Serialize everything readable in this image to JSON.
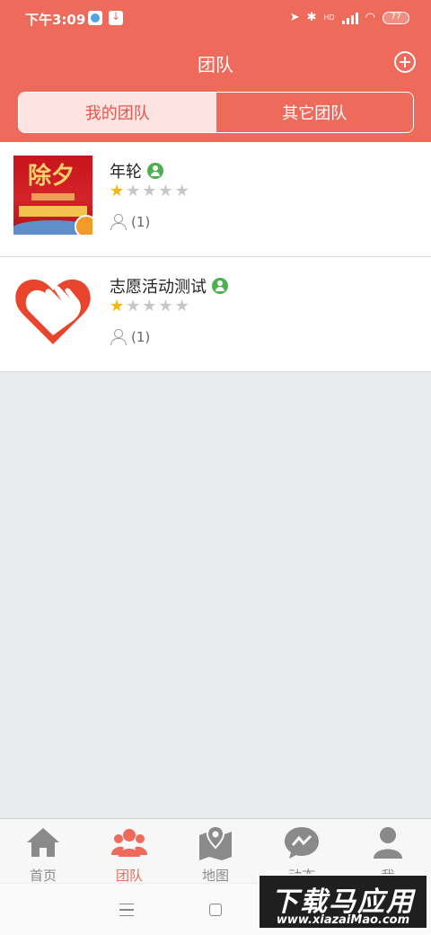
{
  "status_bar": {
    "time": "下午3:09",
    "network": "HD",
    "battery": "77"
  },
  "header": {
    "title": "团队"
  },
  "segments": [
    {
      "label": "我的团队",
      "active": true
    },
    {
      "label": "其它团队",
      "active": false
    }
  ],
  "teams": [
    {
      "name": "年轮",
      "rating": 1,
      "max_rating": 5,
      "members": "(1)",
      "avatar_icon": "new-year-poster"
    },
    {
      "name": "志愿活动测试",
      "rating": 1,
      "max_rating": 5,
      "members": "(1)",
      "avatar_icon": "volunteer-heart-hand"
    }
  ],
  "tabbar": [
    {
      "label": "首页",
      "icon": "home-icon",
      "active": false
    },
    {
      "label": "团队",
      "icon": "team-icon",
      "active": true
    },
    {
      "label": "地图",
      "icon": "map-icon",
      "active": false
    },
    {
      "label": "动态",
      "icon": "message-icon",
      "active": false
    },
    {
      "label": "我",
      "icon": "profile-icon",
      "active": false
    }
  ],
  "watermark": {
    "title": "下载马应用",
    "url": "www.xiazaiMao.com"
  },
  "colors": {
    "primary": "#ee6a5b",
    "segment_active_bg": "#fde3e1",
    "star_on": "#f5b700",
    "verified": "#4caf50",
    "page_bg": "#e8ebeb"
  }
}
